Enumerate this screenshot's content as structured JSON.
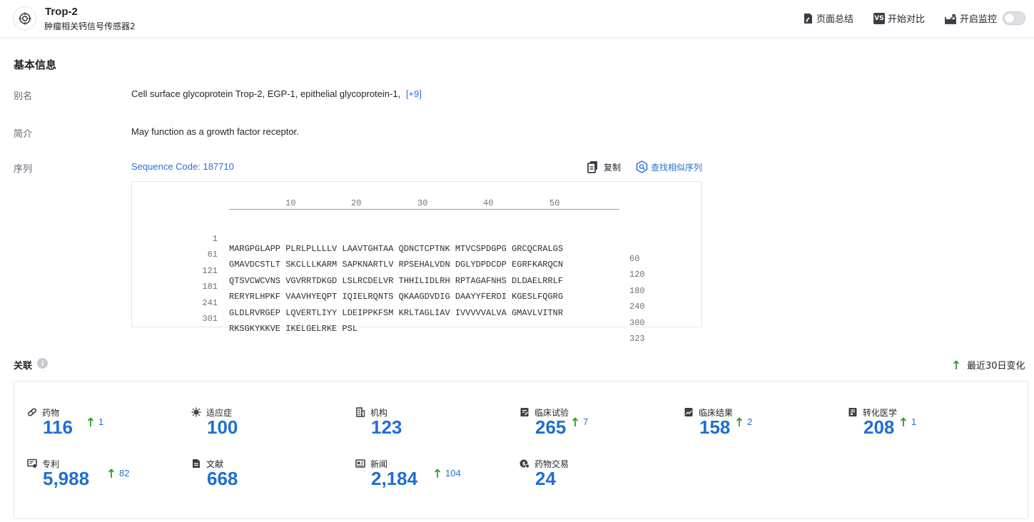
{
  "header": {
    "title": "Trop-2",
    "subtitle": "肿瘤相关钙信号传感器2",
    "actions": {
      "summary": "页面总结",
      "compare": "开始对比",
      "monitor": "开启监控"
    },
    "compare_badge": "VS",
    "monitor_enabled": false
  },
  "basic": {
    "section_title": "基本信息",
    "alias_label": "别名",
    "alias_value": "Cell surface glycoprotein Trop-2,  EGP-1,  epithelial glycoprotein-1,",
    "alias_more": "[+9]",
    "summary_label": "简介",
    "summary_value": "May function as a growth factor receptor.",
    "sequence_label": "序列",
    "sequence_code": "Sequence Code: 187710",
    "copy_label": "复制",
    "find_similar_label": "查找相似序列"
  },
  "sequence": {
    "ruler": [
      "10",
      "20",
      "30",
      "40",
      "50"
    ],
    "rows": [
      {
        "start": "1",
        "seq": "MARGPGLAPP PLRLPLLLLV LAAVTGHTAA QDNCTCPTNK MTVCSPDGPG GRCQCRALGS",
        "end": "60"
      },
      {
        "start": "61",
        "seq": "GMAVDCSTLT SKCLLLKARM SAPKNARTLV RPSEHALVDN DGLYDPDCDP EGRFKARQCN",
        "end": "120"
      },
      {
        "start": "121",
        "seq": "QTSVCWCVNS VGVRRTDKGD LSLRCDELVR THHILIDLRH RPTAGAFNHS DLDAELRRLF",
        "end": "180"
      },
      {
        "start": "181",
        "seq": "RERYRLHPKF VAAVHYEQPT IQIELRQNTS QKAAGDVDIG DAAYYFERDI KGESLFQGRG",
        "end": "240"
      },
      {
        "start": "241",
        "seq": "GLDLRVRGEP LQVERTLIYY LDEIPPKFSM KRLTAGLIAV IVVVVVALVA GMAVLVITNR",
        "end": "300"
      },
      {
        "start": "301",
        "seq": "RKSGKYKKVE IKELGELRKE PSL",
        "end": "323"
      }
    ]
  },
  "related": {
    "section_title": "关联",
    "info_glyph": "i",
    "recent_change_label": "最近30日变化",
    "accent_color": "#1e6fd3",
    "up_color": "#2e9a2e",
    "stats": [
      {
        "label": "药物",
        "value": "116",
        "delta": "1",
        "icon": "pill-icon"
      },
      {
        "label": "适应症",
        "value": "100",
        "delta": "",
        "icon": "virus-icon"
      },
      {
        "label": "机构",
        "value": "123",
        "delta": "",
        "icon": "building-icon"
      },
      {
        "label": "临床试验",
        "value": "265",
        "delta": "7",
        "icon": "clipboard-icon"
      },
      {
        "label": "临床结果",
        "value": "158",
        "delta": "2",
        "icon": "chart-doc-icon"
      },
      {
        "label": "转化医学",
        "value": "208",
        "delta": "1",
        "icon": "medical-doc-icon"
      },
      {
        "label": "专利",
        "value": "5,988",
        "delta": "82",
        "icon": "patent-icon"
      },
      {
        "label": "文献",
        "value": "668",
        "delta": "",
        "icon": "document-icon"
      },
      {
        "label": "新闻",
        "value": "2,184",
        "delta": "104",
        "icon": "news-icon"
      },
      {
        "label": "药物交易",
        "value": "24",
        "delta": "",
        "icon": "deal-icon"
      }
    ]
  }
}
